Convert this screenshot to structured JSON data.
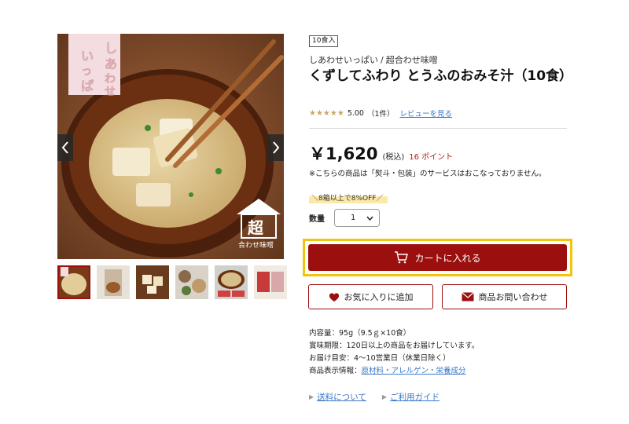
{
  "gallery": {
    "logo_text": "しあわせいっぱい",
    "badge_top": "超",
    "badge_bottom": "合わせ味噌",
    "prev_arrow": "chevron-left-icon",
    "next_arrow": "chevron-right-icon",
    "thumbnails": [
      "miso-soup-bowl",
      "package",
      "tofu-cubes",
      "ingredients",
      "soup-closeup",
      "package-set"
    ]
  },
  "product": {
    "badge": "10食入",
    "brand": "しあわせいっぱい",
    "brand_sep": "/",
    "series": "超合わせ味噌",
    "title": "くずしてふわり とうふのおみそ汁（10食）",
    "rating_stars": "★★★★★",
    "rating_value": "5.00",
    "review_count": "（1件）",
    "review_link": "レビューを見る",
    "price": "￥1,620",
    "tax_label": "(税込)",
    "points": "16 ポイント",
    "notice": "※こちらの商品は「熨斗・包装」のサービスはおこなっておりません。",
    "promo": "＼8箱以上で8%OFF／",
    "qty_label": "数量",
    "qty_value": "1",
    "cart_button": "カートに入れる",
    "favorite_button": "お気に入りに追加",
    "inquiry_button": "商品お問い合わせ"
  },
  "details": {
    "content": "内容量：95g（9.5ｇ×10食）",
    "expiry": "賞味期限：120日以上の商品をお届けしています。",
    "delivery": "お届け目安：4～10営業日（休業日除く）",
    "info_label": "商品表示情報：",
    "info_link": "原材料・アレルゲン・栄養成分"
  },
  "links": {
    "shipping": "送料について",
    "guide": "ご利用ガイド"
  },
  "colors": {
    "accent": "#9c0f0f",
    "highlight_frame": "#f2c40a",
    "link": "#3a78c8",
    "star": "#c7a862"
  }
}
